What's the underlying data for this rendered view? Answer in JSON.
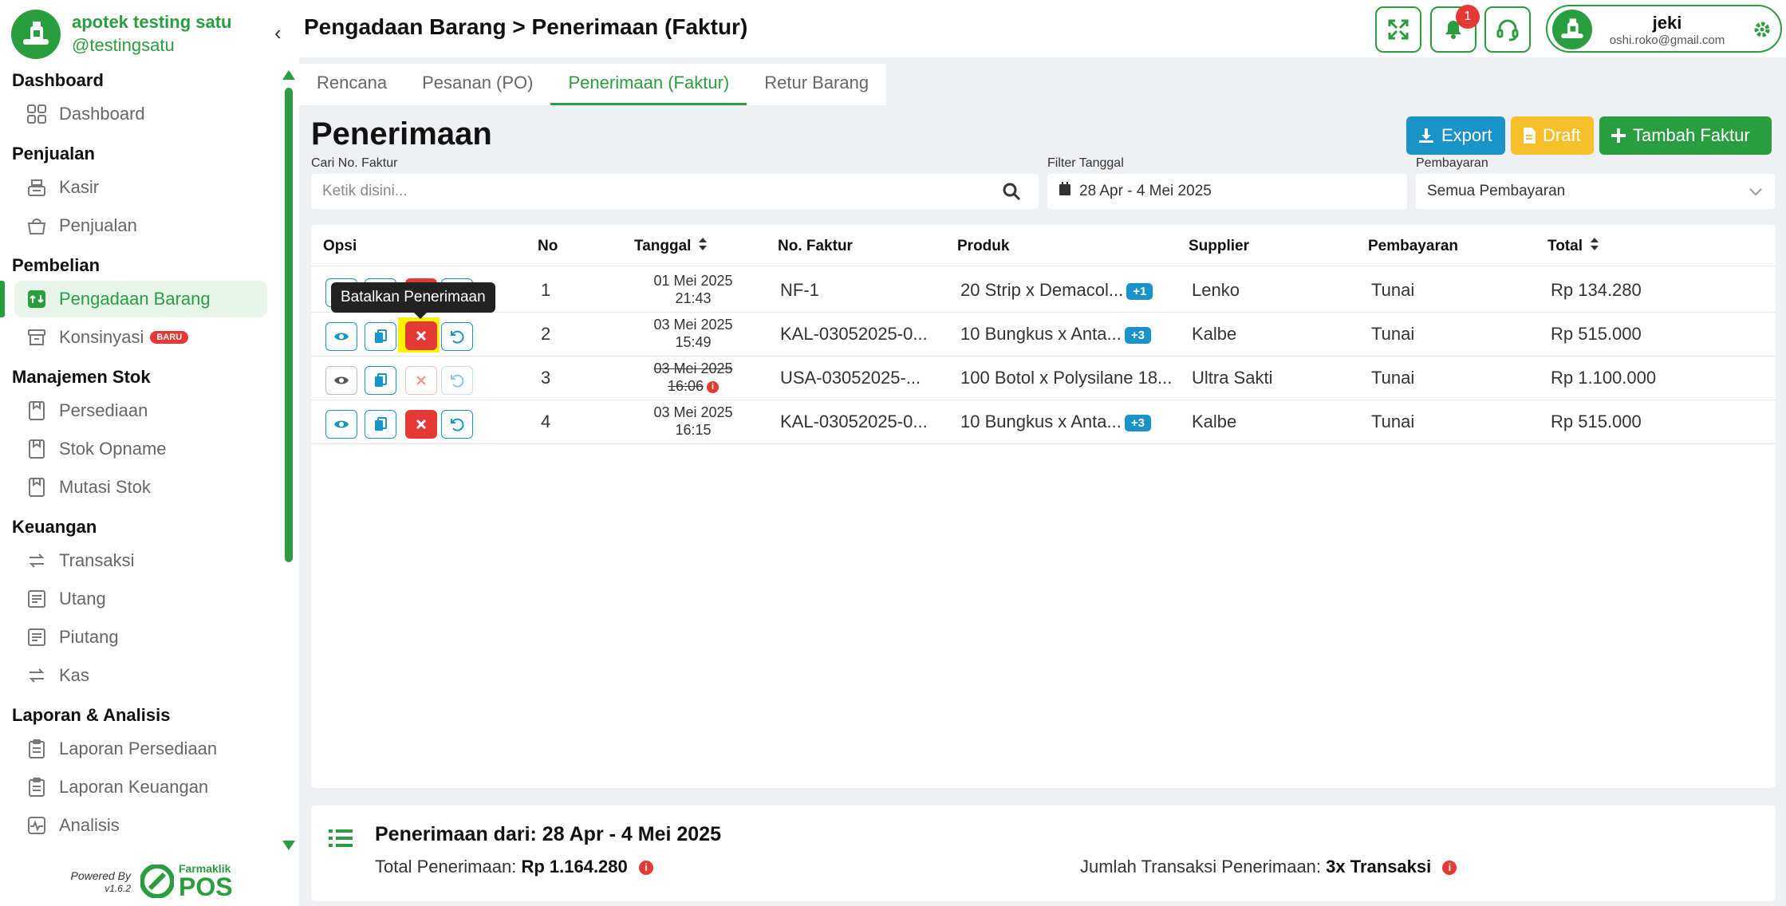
{
  "brand": {
    "name": "apotek testing satu",
    "handle": "@testingsatu"
  },
  "sidebar": {
    "sections": [
      {
        "title": "Dashboard",
        "items": [
          {
            "label": "Dashboard",
            "icon": "grid-icon"
          }
        ]
      },
      {
        "title": "Penjualan",
        "items": [
          {
            "label": "Kasir",
            "icon": "cash-register-icon"
          },
          {
            "label": "Penjualan",
            "icon": "basket-icon"
          }
        ]
      },
      {
        "title": "Pembelian",
        "items": [
          {
            "label": "Pengadaan Barang",
            "icon": "procurement-icon",
            "active": true
          },
          {
            "label": "Konsinyasi",
            "icon": "archive-icon",
            "badge": "BARU"
          }
        ]
      },
      {
        "title": "Manajemen Stok",
        "items": [
          {
            "label": "Persediaan",
            "icon": "inventory-icon"
          },
          {
            "label": "Stok Opname",
            "icon": "stock-opname-icon"
          },
          {
            "label": "Mutasi Stok",
            "icon": "stock-mutation-icon"
          }
        ]
      },
      {
        "title": "Keuangan",
        "items": [
          {
            "label": "Transaksi",
            "icon": "transfer-icon"
          },
          {
            "label": "Utang",
            "icon": "receipt-icon"
          },
          {
            "label": "Piutang",
            "icon": "receipt-icon"
          },
          {
            "label": "Kas",
            "icon": "transfer-icon"
          }
        ]
      },
      {
        "title": "Laporan & Analisis",
        "items": [
          {
            "label": "Laporan Persediaan",
            "icon": "clipboard-icon"
          },
          {
            "label": "Laporan Keuangan",
            "icon": "clipboard-icon"
          },
          {
            "label": "Analisis",
            "icon": "pulse-icon"
          }
        ]
      }
    ],
    "powered_by": "Powered By",
    "version": "v1.6.2",
    "logo_text_top": "Farmaklik",
    "logo_text_bottom": "POS"
  },
  "header": {
    "title": "Pengadaan Barang > Penerimaan (Faktur)",
    "notification_count": "1",
    "user": {
      "name": "jeki",
      "email": "oshi.roko@gmail.com"
    }
  },
  "tabs": [
    "Rencana",
    "Pesanan (PO)",
    "Penerimaan (Faktur)",
    "Retur Barang"
  ],
  "active_tab": "Penerimaan (Faktur)",
  "main": {
    "heading": "Penerimaan",
    "buttons": {
      "export": "Export",
      "draft": "Draft",
      "add": "Tambah Faktur"
    },
    "filters": {
      "search_label": "Cari No. Faktur",
      "search_placeholder": "Ketik disini...",
      "date_label": "Filter Tanggal",
      "date_value": "28 Apr - 4 Mei 2025",
      "payment_label": "Pembayaran",
      "payment_value": "Semua Pembayaran"
    }
  },
  "table": {
    "columns": [
      "Opsi",
      "No",
      "Tanggal",
      "No. Faktur",
      "Produk",
      "Supplier",
      "Pembayaran",
      "Total"
    ],
    "rows": [
      {
        "no": "1",
        "date": "01 Mei 2025",
        "time": "21:43",
        "faktur": "NF-1",
        "produk": "20 Strip x Demacol...",
        "extra": "+1",
        "supplier": "Lenko",
        "pembayaran": "Tunai",
        "total": "Rp 134.280"
      },
      {
        "no": "2",
        "date": "03 Mei 2025",
        "time": "15:49",
        "faktur": "KAL-03052025-0...",
        "produk": "10 Bungkus x Anta...",
        "extra": "+3",
        "supplier": "Kalbe",
        "pembayaran": "Tunai",
        "total": "Rp 515.000"
      },
      {
        "no": "3",
        "date": "03 Mei 2025",
        "time": "16:06",
        "faktur": "USA-03052025-...",
        "produk": "100 Botol x Polysilane 18...",
        "extra": "",
        "supplier": "Ultra Sakti",
        "pembayaran": "Tunai",
        "total": "Rp 1.100.000",
        "cancelled": true
      },
      {
        "no": "4",
        "date": "03 Mei 2025",
        "time": "16:15",
        "faktur": "KAL-03052025-0...",
        "produk": "10 Bungkus x Anta...",
        "extra": "+3",
        "supplier": "Kalbe",
        "pembayaran": "Tunai",
        "total": "Rp 515.000"
      }
    ],
    "tooltip": "Batalkan Penerimaan"
  },
  "summary": {
    "title": "Penerimaan dari: 28 Apr - 4 Mei 2025",
    "total_label": "Total Penerimaan:",
    "total_value": "Rp 1.164.280",
    "count_label": "Jumlah Transaksi Penerimaan:",
    "count_value": "3x Transaksi"
  },
  "colors": {
    "primary": "#2a9d3f",
    "info": "#1a93c9",
    "danger": "#e53935",
    "warning": "#f7c02b"
  }
}
